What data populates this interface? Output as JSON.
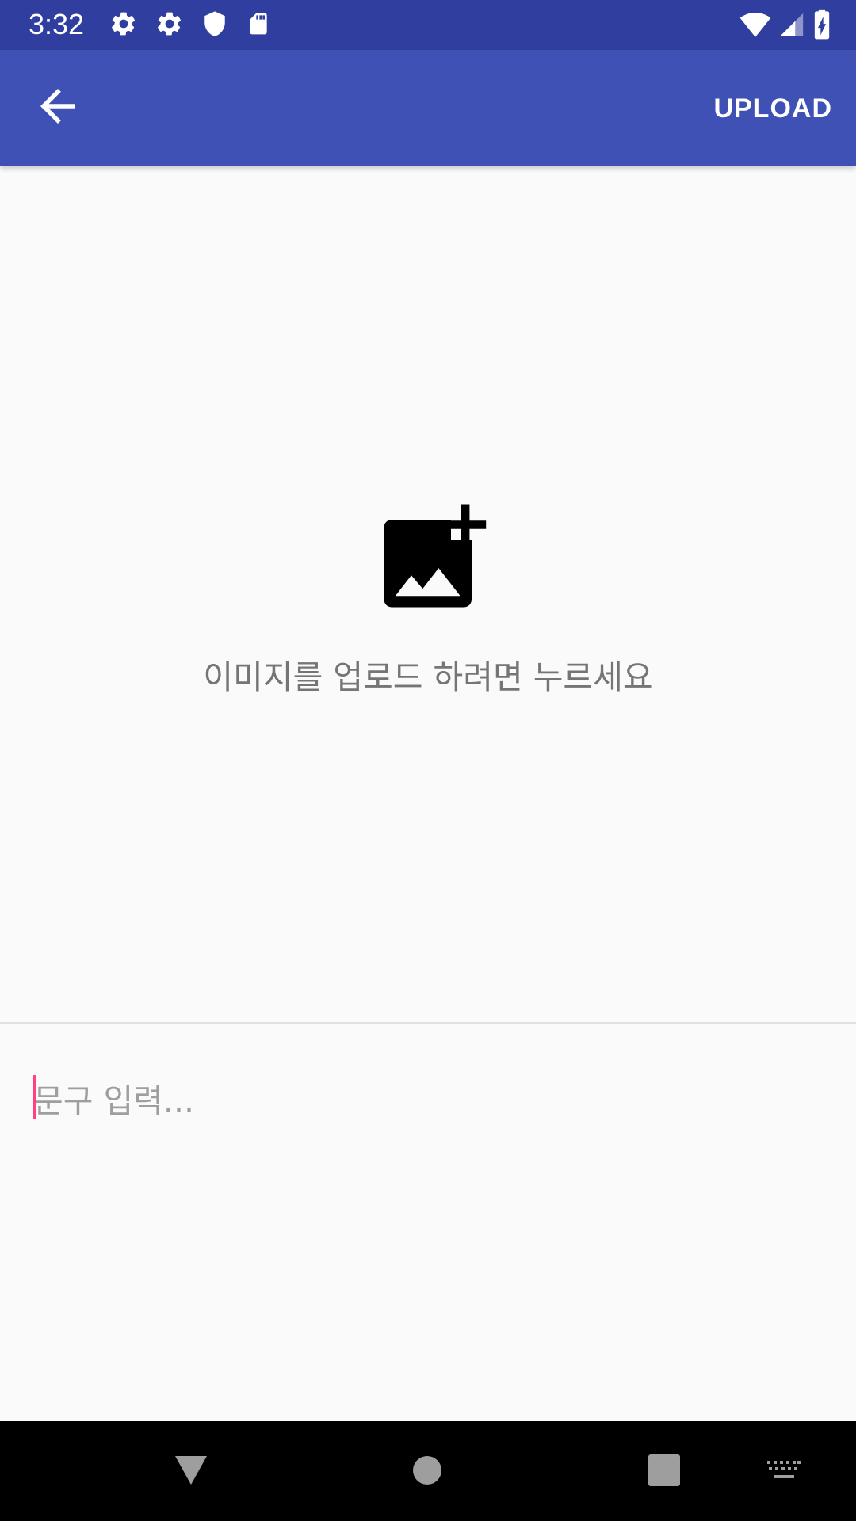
{
  "status_bar": {
    "time": "3:32",
    "background_color": "#303f9f",
    "left_icons": [
      "settings-icon",
      "settings-icon",
      "shield-icon",
      "sd-card-icon"
    ],
    "right_icons": [
      "wifi-icon",
      "cell-signal-icon",
      "battery-charging-icon"
    ]
  },
  "app_bar": {
    "background_color": "#3f51b5",
    "back_icon": "arrow-back-icon",
    "upload_label": "UPLOAD"
  },
  "image_picker": {
    "icon": "add-photo-icon",
    "hint": "이미지를 업로드 하려면 누르세요"
  },
  "caption": {
    "value": "",
    "placeholder": "문구 입력...",
    "cursor_color": "#ff4081"
  },
  "nav_bar": {
    "buttons": [
      "back-triangle-icon",
      "home-circle-icon",
      "recents-square-icon",
      "keyboard-icon"
    ]
  }
}
